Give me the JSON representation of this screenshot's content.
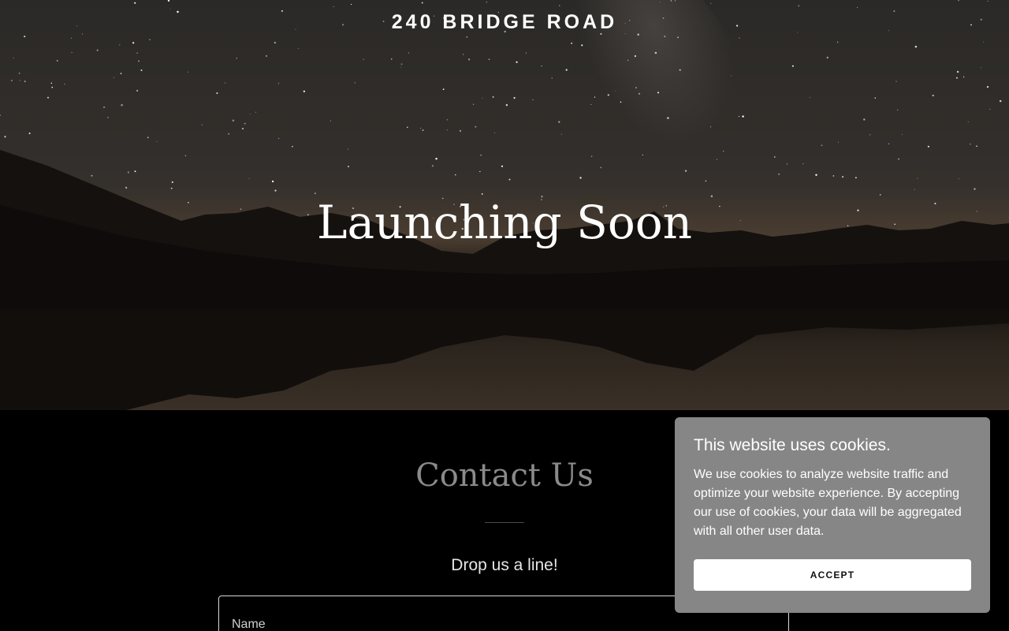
{
  "header": {
    "site_title": "240 BRIDGE ROAD"
  },
  "hero": {
    "heading": "Launching Soon",
    "background": "night-sky-mountain-lake-photo"
  },
  "contact": {
    "title": "Contact Us",
    "subtitle": "Drop us a line!",
    "name_placeholder": "Name"
  },
  "cookie_banner": {
    "title": "This website uses cookies.",
    "body": "We use cookies to analyze website traffic and optimize your website experience. By accepting our use of cookies, your data will be aggregated with all other user data.",
    "accept_label": "ACCEPT"
  },
  "colors": {
    "page_background": "#000000",
    "contact_title": "#8a8a8a",
    "cookie_background": "#868686",
    "button_background": "#ffffff"
  }
}
